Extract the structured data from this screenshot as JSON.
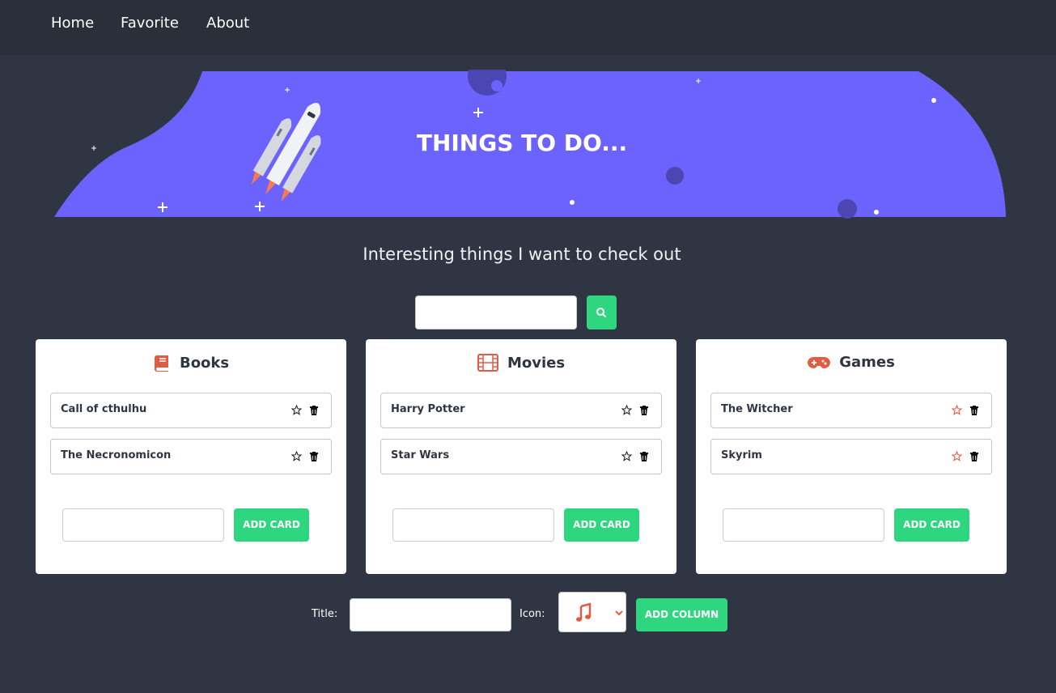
{
  "nav": {
    "home": "Home",
    "favorite": "Favorite",
    "about": "About"
  },
  "hero": {
    "title": "THINGS TO DO..."
  },
  "subtitle": "Interesting things I want to check out",
  "search": {
    "value": "",
    "icon": "search-icon"
  },
  "columns": [
    {
      "title": "Books",
      "icon": "book-icon",
      "cards": [
        {
          "text": "Call of cthulhu",
          "favorite": false
        },
        {
          "text": "The Necronomicon",
          "favorite": false
        }
      ],
      "add_label": "ADD CARD"
    },
    {
      "title": "Movies",
      "icon": "film-icon",
      "cards": [
        {
          "text": "Harry Potter",
          "favorite": false
        },
        {
          "text": "Star Wars",
          "favorite": false
        }
      ],
      "add_label": "ADD CARD"
    },
    {
      "title": "Games",
      "icon": "gamepad-icon",
      "cards": [
        {
          "text": "The Witcher",
          "favorite": true
        },
        {
          "text": "Skyrim",
          "favorite": true
        }
      ],
      "add_label": "ADD CARD"
    }
  ],
  "footer": {
    "title_label": "Title:",
    "icon_label": "Icon:",
    "icon_selected": "music-icon",
    "add_column_label": "ADD COLUMN"
  },
  "colors": {
    "background": "#2f3542",
    "nav": "#2a2f3a",
    "hero": "#6c63ff",
    "accent": "#2ed67f",
    "icon": "#e05d44"
  }
}
